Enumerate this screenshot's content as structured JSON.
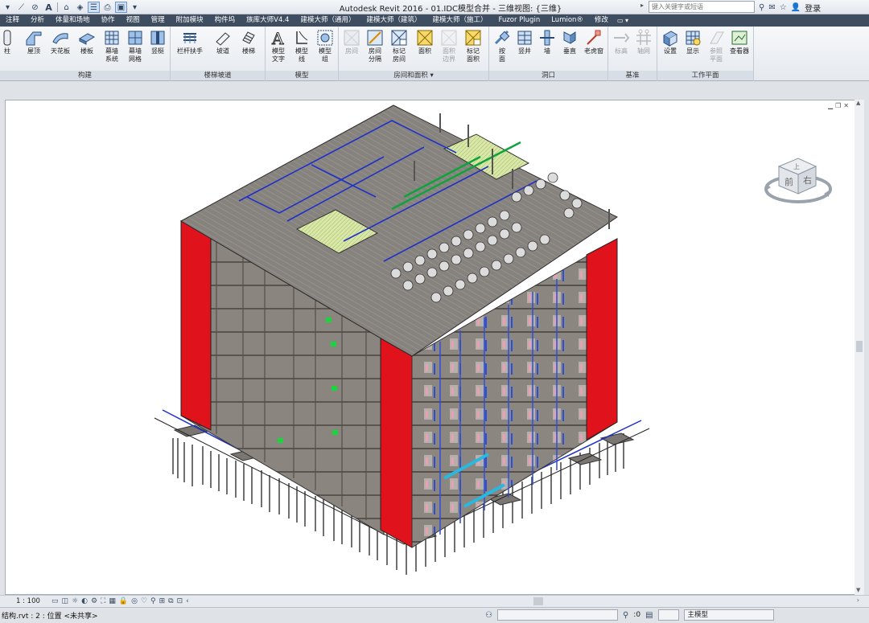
{
  "titlebar": {
    "app_title": "Autodesk Revit 2016 -     01.IDC模型合并 - 三维视图: {三维}",
    "search_placeholder": "键入关键字或短语",
    "login_label": "登录"
  },
  "qat_icons": [
    "open-icon",
    "save-icon",
    "undo-icon",
    "measure-icon",
    "text-icon",
    "sync-icon",
    "thin-lines-icon",
    "print-icon",
    "switch-windows-icon"
  ],
  "tabs": [
    {
      "label": "注释",
      "active": false
    },
    {
      "label": "分析",
      "active": false
    },
    {
      "label": "体量和场地",
      "active": false
    },
    {
      "label": "协作",
      "active": false
    },
    {
      "label": "视图",
      "active": false
    },
    {
      "label": "管理",
      "active": false
    },
    {
      "label": "附加模块",
      "active": false
    },
    {
      "label": "构件坞",
      "active": false
    },
    {
      "label": "族库大师V4.4",
      "active": false
    },
    {
      "label": "建模大师（通用）",
      "active": false
    },
    {
      "label": "建模大师（建筑）",
      "active": false
    },
    {
      "label": "建模大师（施工）",
      "active": false
    },
    {
      "label": "Fuzor Plugin",
      "active": false
    },
    {
      "label": "Lumion®",
      "active": false
    },
    {
      "label": "修改",
      "active": false
    }
  ],
  "ribbon": {
    "groups": [
      {
        "label": "构建",
        "buttons": [
          "柱",
          "屋顶",
          "天花板",
          "楼板",
          "幕墙\n系统",
          "幕墙\n网格",
          "竖梃"
        ]
      },
      {
        "label": "楼梯坡道",
        "buttons": [
          "栏杆扶手",
          "坡道",
          "楼梯"
        ]
      },
      {
        "label": "模型",
        "buttons": [
          "模型\n文字",
          "模型\n线",
          "模型\n组"
        ]
      },
      {
        "label": "房间和面积 ▾",
        "buttons": [
          "房间",
          "房间\n分隔",
          "标记\n房间",
          "面积",
          "面积\n边界",
          "标记\n面积"
        ]
      },
      {
        "label": "洞口",
        "buttons": [
          "按\n面",
          "竖井",
          "墙",
          "垂直",
          "老虎窗"
        ]
      },
      {
        "label": "基准",
        "buttons": [
          "标高",
          "轴网"
        ]
      },
      {
        "label": "工作平面",
        "buttons": [
          "设置",
          "显示",
          "参照\n平面",
          "查看器"
        ]
      }
    ]
  },
  "viewcube": {
    "face_front": "前",
    "face_right": "右",
    "face_top": "上"
  },
  "viewbar": {
    "scale": "1 : 100"
  },
  "status": {
    "left_text": "结构.rvt : 2 : 位置 <未共享>",
    "worksets_count": ":0",
    "main_model": "主模型"
  },
  "colors": {
    "tab_bar": "#3f4d60",
    "facade_red": "#e0121b",
    "roof_hatch": "#d8e6a4",
    "pipe_blue": "#1f3fd6",
    "pipe_green": "#0fa33c"
  }
}
